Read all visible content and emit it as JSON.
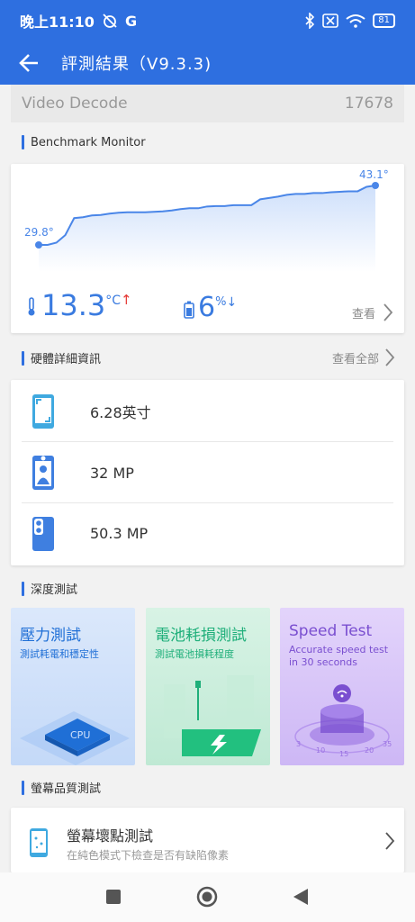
{
  "status": {
    "time": "晚上11:10",
    "carrier_icon": "G",
    "battery": "81"
  },
  "appbar": {
    "title": "評測結果（V9.3.3)"
  },
  "decode": {
    "label": "Video Decode",
    "score": "17678"
  },
  "monitor": {
    "section_title": "Benchmark Monitor",
    "start_label": "29.8°",
    "end_label": "43.1°",
    "temp_value": "13.3",
    "temp_unit": "°C",
    "temp_arrow": "↑",
    "battery_value": "6",
    "battery_unit": "%",
    "battery_arrow": "↓",
    "view_label": "查看"
  },
  "chart_data": {
    "type": "area",
    "title": "",
    "xlabel": "",
    "ylabel": "",
    "ylim": [
      29.8,
      43.1
    ],
    "grid": false,
    "series": [
      {
        "values": [
          29.8,
          29.8,
          30.3,
          32.0,
          35.8,
          36.0,
          36.4,
          36.5,
          36.8,
          37.0,
          37.1,
          37.1,
          37.1,
          37.2,
          37.3,
          37.5,
          37.8,
          38.0,
          38.0,
          38.4,
          38.5,
          38.5,
          38.7,
          38.7,
          38.7,
          40.0,
          40.3,
          40.6,
          41.0,
          41.2,
          41.2,
          41.4,
          41.4,
          41.6,
          41.7,
          41.8,
          41.8,
          42.8,
          43.1
        ]
      }
    ],
    "annotations": [
      "29.8°",
      "43.1°"
    ],
    "line_color": "#4a86e8",
    "fill_color": "#c9dcfa"
  },
  "hardware": {
    "section_title": "硬體詳細資訊",
    "view_all": "查看全部",
    "items": [
      {
        "icon": "phone-screen-icon",
        "value": "6.28英寸"
      },
      {
        "icon": "front-camera-icon",
        "value": "32 MP"
      },
      {
        "icon": "rear-camera-icon",
        "value": "50.3 MP"
      }
    ]
  },
  "deep": {
    "section_title": "深度測試",
    "tiles": [
      {
        "title": "壓力測試",
        "subtitle": "測試耗電和穩定性",
        "color": "#1f6fd6"
      },
      {
        "title": "電池耗損測試",
        "subtitle": "測試電池損耗程度",
        "color": "#1faf7a"
      },
      {
        "title": "Speed Test",
        "subtitle": "Accurate speed test in 30 seconds",
        "color": "#7a4fd0"
      }
    ],
    "speed_ticks": [
      "3",
      "10",
      "15",
      "20",
      "35"
    ]
  },
  "screen": {
    "section_title": "螢幕品質測試",
    "title": "螢幕壞點測試",
    "subtitle": "在純色模式下檢查是否有缺陷像素"
  },
  "colors": {
    "brand": "#2e6fe0",
    "accent": "#3a7be0",
    "up": "#e53935"
  }
}
